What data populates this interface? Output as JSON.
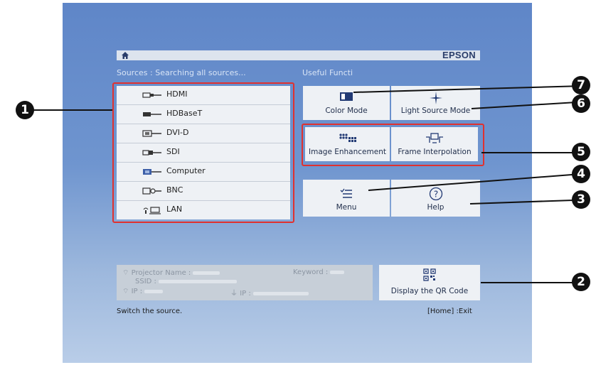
{
  "topbar": {
    "home_icon": "home-icon",
    "brand": "EPSON"
  },
  "sources": {
    "header": "Sources : Searching all sources...",
    "items": [
      {
        "label": "HDMI",
        "icon": "hdmi-icon"
      },
      {
        "label": "HDBaseT",
        "icon": "hdbaset-icon"
      },
      {
        "label": "DVI-D",
        "icon": "dvi-icon"
      },
      {
        "label": "SDI",
        "icon": "sdi-icon"
      },
      {
        "label": "Computer",
        "icon": "computer-icon"
      },
      {
        "label": "BNC",
        "icon": "bnc-icon"
      },
      {
        "label": "LAN",
        "icon": "lan-icon"
      }
    ]
  },
  "functions": {
    "header": "Useful Functi",
    "color_mode": "Color Mode",
    "light_source_mode": "Light Source Mode",
    "image_enhancement": "Image Enhancement",
    "frame_interpolation": "Frame Interpolation",
    "menu": "Menu",
    "help": "Help"
  },
  "info": {
    "projector_name_label": "Projector Name :",
    "keyword_label": "Keyword :",
    "ssid_label": "SSID :",
    "ip_label": "IP :",
    "ip2_label": "IP :",
    "qr_button": "Display the QR Code"
  },
  "footer": {
    "left": "Switch the source.",
    "right": "[Home] :Exit"
  },
  "callouts": [
    "1",
    "2",
    "3",
    "4",
    "5",
    "6",
    "7"
  ],
  "colors": {
    "highlight": "#e0312f",
    "callout": "#111111",
    "screen_bg": "#6f95cf"
  }
}
